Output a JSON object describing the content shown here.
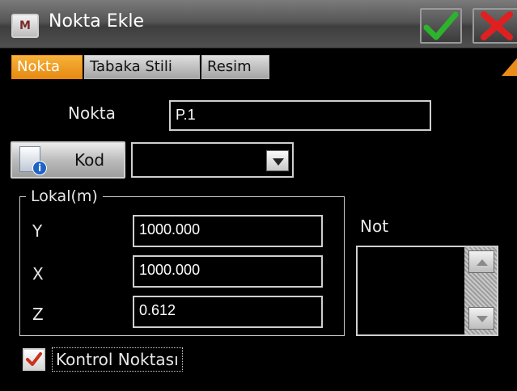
{
  "window": {
    "title": "Nokta Ekle",
    "app_icon_text": "M"
  },
  "toolbar": {
    "ok_icon": "checkmark-icon",
    "cancel_icon": "close-icon",
    "ok_color": "#2db32d",
    "cancel_color": "#e02020"
  },
  "tabs": [
    {
      "label": "Nokta",
      "active": true
    },
    {
      "label": "Tabaka Stili",
      "active": false
    },
    {
      "label": "Resim",
      "active": false
    }
  ],
  "accent_color": "#e98c18",
  "form": {
    "nokta_label": "Nokta",
    "nokta_value": "P.1",
    "kod_button_label": "Kod",
    "kod_value": "",
    "group_label": "Lokal(m)",
    "y_label": "Y",
    "y_value": "1000.000",
    "x_label": "X",
    "x_value": "1000.000",
    "z_label": "Z",
    "z_value": "0.612",
    "note_label": "Not",
    "note_value": "",
    "control_point_label": "Kontrol Noktası",
    "control_point_checked": true
  }
}
